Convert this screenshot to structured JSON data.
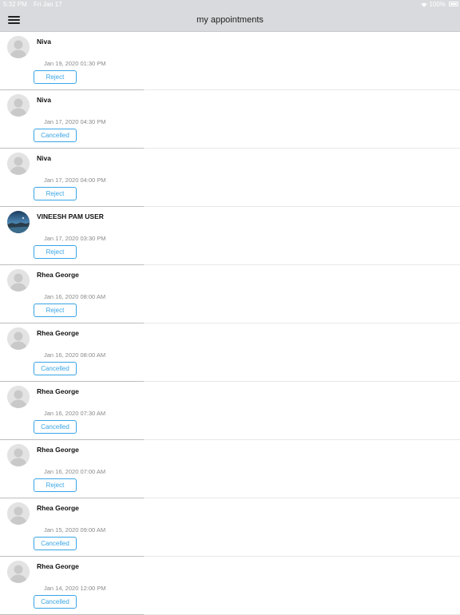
{
  "status_bar": {
    "time": "5:32 PM",
    "date": "Fri Jan 17",
    "battery": "100%"
  },
  "header": {
    "title": "my appointments",
    "menu_icon": "hamburger-menu-icon"
  },
  "appointments": [
    {
      "name": "Niva",
      "datetime": "Jan 19, 2020 01:30 PM",
      "action": "Reject",
      "avatar": "placeholder"
    },
    {
      "name": "Niva",
      "datetime": "Jan 17, 2020 04:30 PM",
      "action": "Cancelled",
      "avatar": "placeholder"
    },
    {
      "name": "Niva",
      "datetime": "Jan 17, 2020 04:00 PM",
      "action": "Reject",
      "avatar": "placeholder"
    },
    {
      "name": "VINEESH PAM USER",
      "datetime": "Jan 17, 2020 03:30 PM",
      "action": "Reject",
      "avatar": "photo"
    },
    {
      "name": "Rhea George",
      "datetime": "Jan 16, 2020 08:00 AM",
      "action": "Reject",
      "avatar": "placeholder"
    },
    {
      "name": "Rhea George",
      "datetime": "Jan 16, 2020 08:00 AM",
      "action": "Cancelled",
      "avatar": "placeholder"
    },
    {
      "name": "Rhea George",
      "datetime": "Jan 16, 2020 07:30 AM",
      "action": "Cancelled",
      "avatar": "placeholder"
    },
    {
      "name": "Rhea George",
      "datetime": "Jan 16, 2020 07:00 AM",
      "action": "Reject",
      "avatar": "placeholder"
    },
    {
      "name": "Rhea George",
      "datetime": "Jan 15, 2020 09:00 AM",
      "action": "Cancelled",
      "avatar": "placeholder"
    },
    {
      "name": "Rhea George",
      "datetime": "Jan 14, 2020 12:00 PM",
      "action": "Cancelled",
      "avatar": "placeholder"
    }
  ],
  "colors": {
    "accent": "#39a5e6",
    "nav_background": "#d9dadd",
    "divider": "#bdbdbd"
  }
}
